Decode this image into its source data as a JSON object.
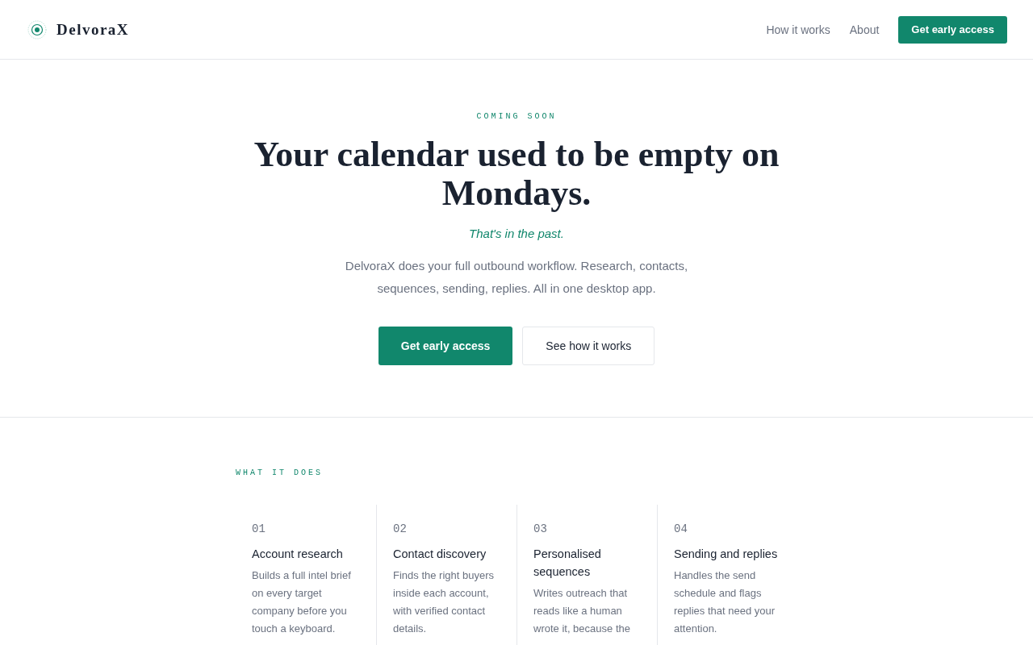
{
  "header": {
    "brand": "DelvoraX",
    "nav": [
      {
        "label": "How it works"
      },
      {
        "label": "About"
      }
    ],
    "cta": "Get early access"
  },
  "hero": {
    "eyebrow": "COMING SOON",
    "title": "Your calendar used to be empty on Mondays.",
    "tagline": "That's in the past.",
    "description": "DelvoraX does your full outbound workflow. Research, contacts, sequences, sending, replies. All in one desktop app.",
    "buttons": [
      {
        "label": "Get early access",
        "kind": "primary"
      },
      {
        "label": "See how it works",
        "kind": "secondary"
      }
    ]
  },
  "features": {
    "eyebrow": "WHAT IT DOES",
    "items": [
      {
        "number": "01",
        "title": "Account research",
        "description": "Builds a full intel brief on every target company before you touch a keyboard."
      },
      {
        "number": "02",
        "title": "Contact discovery",
        "description": "Finds the right buyers inside each account, with verified contact details."
      },
      {
        "number": "03",
        "title": "Personalised sequences",
        "description": "Writes outreach that reads like a human wrote it, because the"
      },
      {
        "number": "04",
        "title": "Sending and replies",
        "description": "Handles the send schedule and flags replies that need your attention."
      }
    ]
  }
}
